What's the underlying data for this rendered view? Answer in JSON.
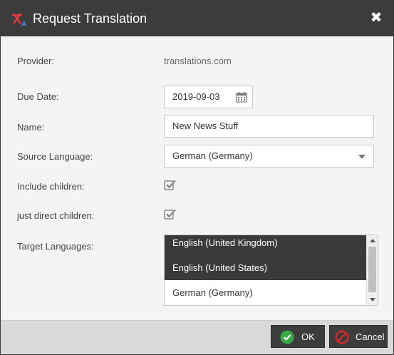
{
  "dialog": {
    "title": "Request Translation",
    "close_label": "✖"
  },
  "form": {
    "provider_label": "Provider:",
    "provider_value": "translations.com",
    "due_date_label": "Due Date:",
    "due_date_value": "2019-09-03",
    "name_label": "Name:",
    "name_value": "New News Stuff",
    "source_language_label": "Source Language:",
    "source_language_value": "German (Germany)",
    "include_children_label": "Include children:",
    "include_children_checked": true,
    "just_direct_children_label": "just direct children:",
    "just_direct_children_checked": true,
    "target_languages_label": "Target Languages:",
    "target_languages": [
      {
        "label": "English (United Kingdom)",
        "selected": true
      },
      {
        "label": "English (United States)",
        "selected": true
      },
      {
        "label": "German (Germany)",
        "selected": false
      }
    ]
  },
  "footer": {
    "ok_label": "OK",
    "cancel_label": "Cancel"
  },
  "icons": {
    "app": "translate-icon",
    "calendar": "calendar-icon",
    "ok": "check-circle-icon",
    "cancel": "prohibited-icon"
  },
  "colors": {
    "titlebar": "#3c3c3c",
    "selected_option": "#3a3a3a",
    "ok_green": "#3aa845",
    "cancel_red": "#d9262b"
  }
}
